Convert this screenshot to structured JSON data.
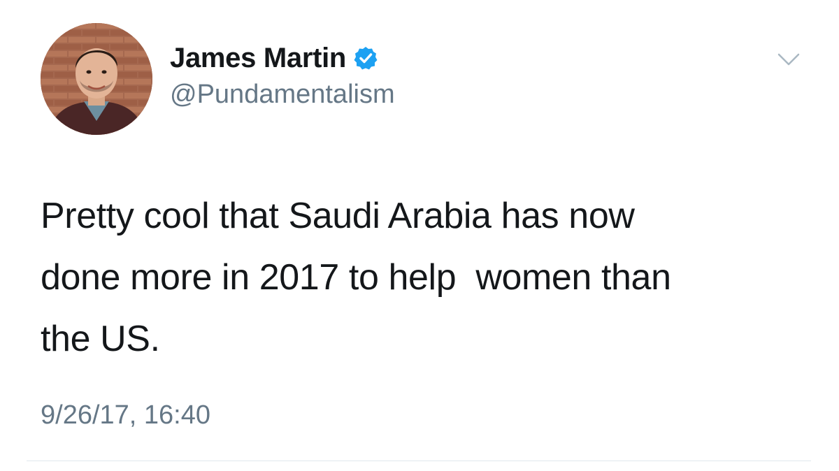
{
  "tweet": {
    "author": {
      "display_name": "James Martin",
      "handle": "@Pundamentalism",
      "verified": true,
      "avatar_icon": "avatar-photo"
    },
    "text": "Pretty cool that Saudi Arabia has now\ndone more in 2017 to help  women than\nthe US.",
    "timestamp": "9/26/17, 16:40",
    "menu_icon": "chevron-down-icon"
  },
  "colors": {
    "verified_blue": "#1da1f2",
    "secondary_text": "#657786",
    "primary_text": "#14171a",
    "divider": "#e1e8ed"
  }
}
